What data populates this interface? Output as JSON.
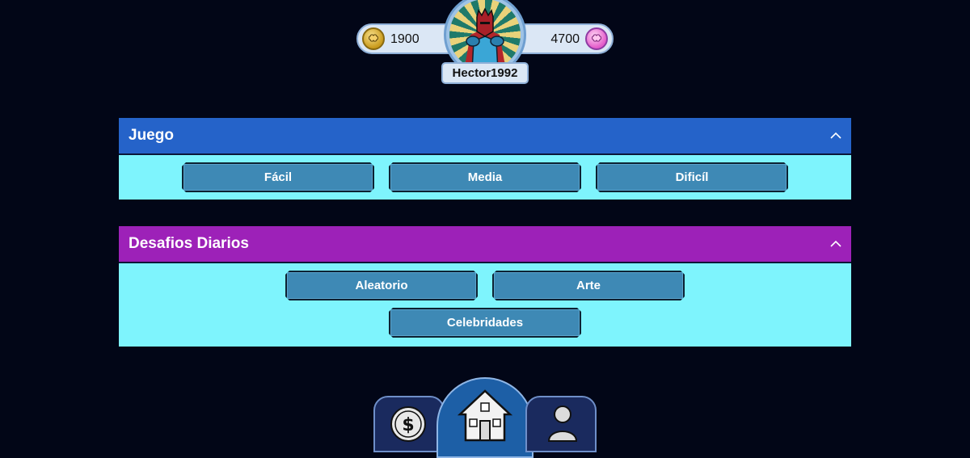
{
  "player": {
    "coins": "1900",
    "gems": "4700",
    "username": "Hector1992"
  },
  "sections": [
    {
      "title": "Juego",
      "color": "#2563c9",
      "buttons": [
        "Fácil",
        "Media",
        "Dificíl"
      ]
    },
    {
      "title": "Desafios Diarios",
      "color": "#9d21b8",
      "buttons": [
        "Aleatorio",
        "Arte",
        "Celebridades"
      ]
    }
  ],
  "nav": {
    "items": [
      "coin-shop-icon",
      "home-icon",
      "profile-icon"
    ],
    "active": "home-icon"
  },
  "colors": {
    "background": "#020617",
    "panel_body": "#7ef4fd",
    "button": "#3e89b5"
  }
}
